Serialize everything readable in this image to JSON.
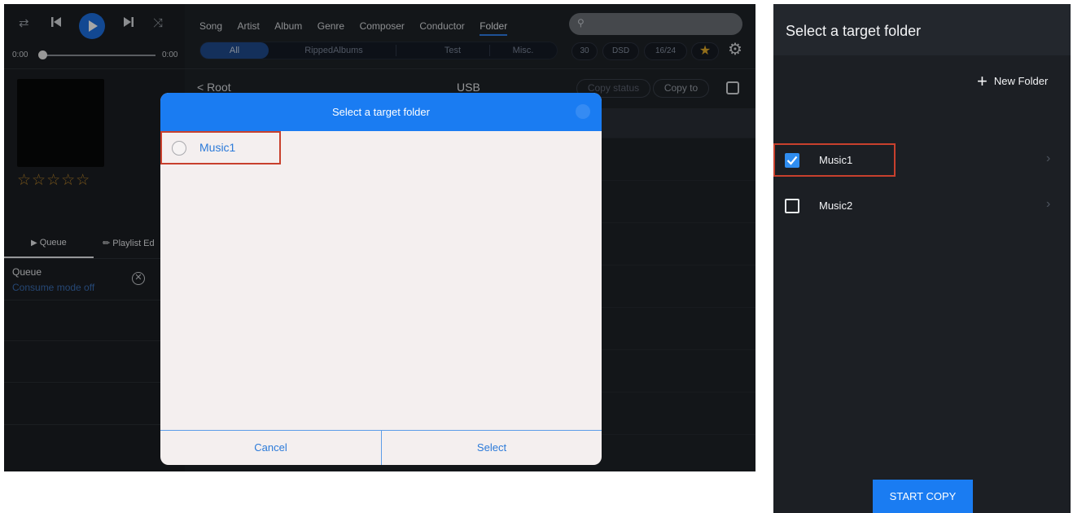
{
  "tablet": {
    "player": {
      "time_elapsed": "0:00",
      "time_total": "0:00",
      "rating_stars": "☆☆☆☆☆",
      "tabs": {
        "queue": "Queue",
        "playlist": "Playlist Ed"
      },
      "queue": {
        "title": "Queue",
        "subtitle": "Consume mode off"
      }
    },
    "library": {
      "nav_tabs": [
        "Song",
        "Artist",
        "Album",
        "Genre",
        "Composer",
        "Conductor",
        "Folder"
      ],
      "active_tab": "Folder",
      "segments": [
        "All",
        "RippedAlbums",
        "Test",
        "Misc."
      ],
      "active_segment": "All",
      "chips": [
        "30",
        "DSD",
        "16/24"
      ],
      "back_label": "< Root",
      "title": "USB",
      "copy_status": "Copy status",
      "copy_to": "Copy to"
    },
    "dialog": {
      "title": "Select a target folder",
      "folder": "Music1",
      "cancel": "Cancel",
      "select": "Select",
      "accent": "#1a7cf2",
      "highlight": "#c8402d"
    }
  },
  "phone": {
    "title": "Select a target folder",
    "new_folder": "New Folder",
    "folders": [
      {
        "name": "Music1",
        "checked": true
      },
      {
        "name": "Music2",
        "checked": false
      }
    ],
    "start_copy": "START COPY"
  }
}
